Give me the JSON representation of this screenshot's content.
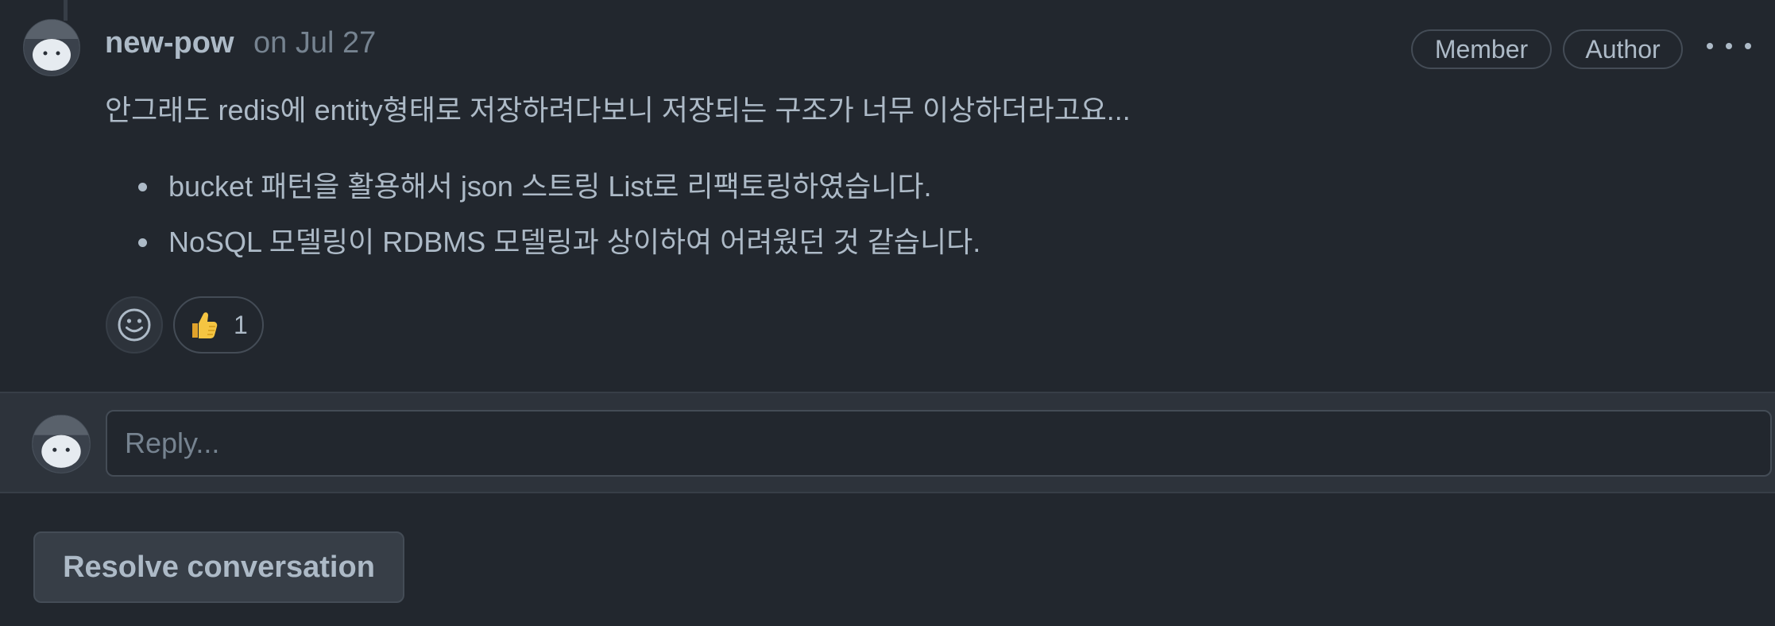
{
  "comment": {
    "author": "new-pow",
    "date": "on Jul 27",
    "badges": [
      "Member",
      "Author"
    ],
    "body": "안그래도 redis에 entity형태로 저장하려다보니 저장되는 구조가 너무 이상하더라고요...",
    "bullets": [
      "bucket 패턴을 활용해서 json 스트링 List로 리팩토링하였습니다.",
      "NoSQL 모델링이 RDBMS 모델링과 상이하여 어려웠던 것 같습니다."
    ],
    "reactions": [
      {
        "icon": "thumbs-up-icon",
        "count": "1"
      }
    ]
  },
  "reply": {
    "placeholder": "Reply..."
  },
  "actions": {
    "resolve_label": "Resolve conversation"
  },
  "colors": {
    "background": "#22272e",
    "text": "#adbac7",
    "muted": "#768390",
    "border": "#444c56"
  }
}
